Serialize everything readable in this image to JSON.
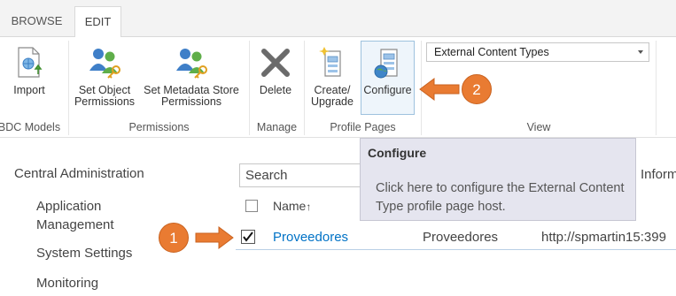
{
  "tabs": [
    {
      "label": "BROWSE"
    },
    {
      "label": "EDIT"
    }
  ],
  "ribbon": {
    "groups": {
      "bdc_models": "BDC Models",
      "permissions": "Permissions",
      "manage": "Manage",
      "profile_pages": "Profile Pages",
      "view": "View"
    },
    "buttons": {
      "import": "Import",
      "set_object_permissions": [
        "Set Object",
        "Permissions"
      ],
      "set_metadata_store_permissions": [
        "Set Metadata Store",
        "Permissions"
      ],
      "delete": "Delete",
      "create_upgrade": [
        "Create/",
        "Upgrade"
      ],
      "configure": "Configure"
    },
    "view_select": {
      "value": "External Content Types"
    }
  },
  "callouts": {
    "one": "1",
    "two": "2"
  },
  "nav": {
    "root": "Central Administration",
    "items": [
      [
        "Application",
        "Management"
      ],
      [
        "System Settings"
      ],
      [
        "Monitoring"
      ]
    ]
  },
  "search": {
    "placeholder": "Search"
  },
  "tooltip": {
    "title": "Configure",
    "body": "Click here to configure the External Content Type profile page host."
  },
  "table": {
    "header_name": "Name",
    "header_sort_glyph": "↑",
    "header_partial": "Inform",
    "rows": [
      {
        "name": "Proveedores",
        "display_name": "Proveedores",
        "url": "http://spmartin15:399",
        "checked": true
      }
    ]
  },
  "colors": {
    "accent_orange": "#e97b32",
    "link_blue": "#0072c6",
    "tooltip_bg": "#e5e5ef"
  }
}
